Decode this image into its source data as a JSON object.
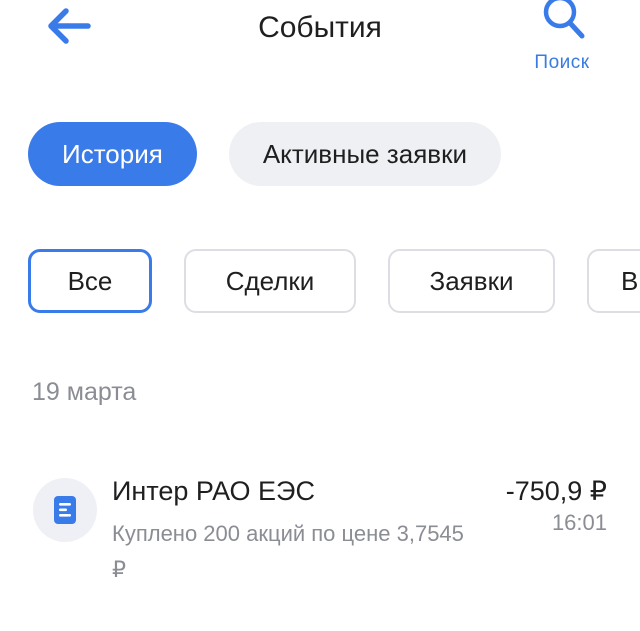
{
  "header": {
    "title": "События",
    "back_icon": "arrow-left-icon",
    "search_label": "Поиск",
    "search_icon": "search-icon",
    "accent_color": "#3a7be0"
  },
  "tabs": [
    {
      "label": "История",
      "active": true
    },
    {
      "label": "Активные заявки",
      "active": false
    }
  ],
  "filters": [
    {
      "label": "Все",
      "selected": true
    },
    {
      "label": "Сделки",
      "selected": false
    },
    {
      "label": "Заявки",
      "selected": false
    },
    {
      "label": "В",
      "selected": false
    }
  ],
  "events": {
    "date": "19 марта",
    "items": [
      {
        "icon": "document-icon",
        "name": "Интер РАО ЕЭС",
        "description": "Куплено 200 акций по цене 3,7545 ₽",
        "amount": "-750,9 ₽",
        "time": "16:01"
      }
    ]
  }
}
